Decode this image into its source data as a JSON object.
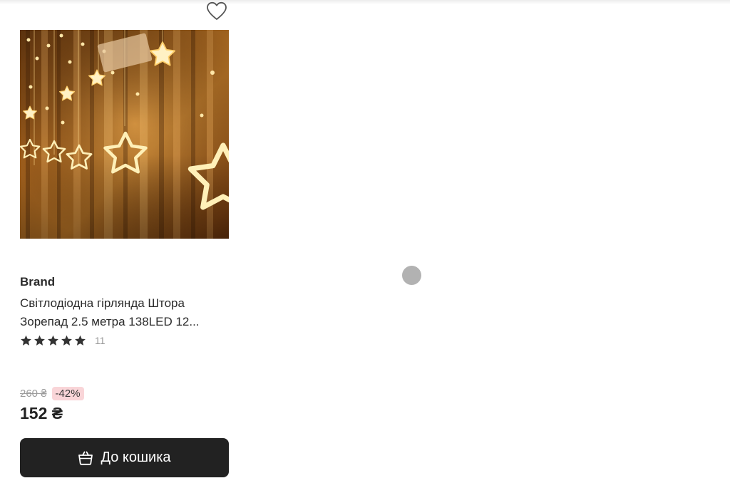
{
  "product": {
    "brand": "Brand",
    "title_line1": "Світлодіодна гірлянда Штора",
    "title_line2": "Зорепад 2.5 метра 138LED 12...",
    "rating_stars": 5,
    "review_count": "11",
    "old_price": "260 ₴",
    "discount": "-42%",
    "price": "152 ₴",
    "image_alt": "LED star curtain garland"
  },
  "actions": {
    "cart_label": "До кошика"
  },
  "icons": {
    "favorite": "heart-outline-icon",
    "star": "star-icon",
    "cart": "basket-icon"
  },
  "colors": {
    "button_bg": "#222222",
    "discount_bg": "#f9d5d8",
    "muted_text": "#9a9a9a"
  }
}
